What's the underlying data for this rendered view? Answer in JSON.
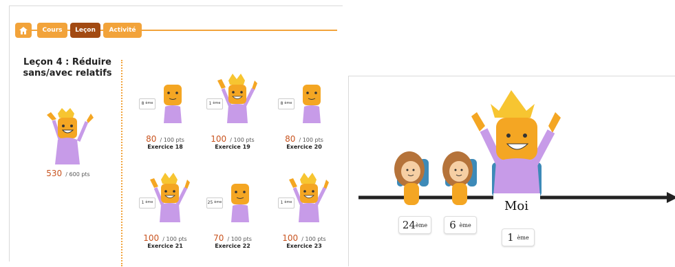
{
  "nav": {
    "tabs": [
      {
        "label": "",
        "icon": "home-icon"
      },
      {
        "label": "Cours"
      },
      {
        "label": "Leçon"
      },
      {
        "label": "Activité"
      }
    ],
    "active_index": 2
  },
  "lesson": {
    "title": "Leçon 4 : Réduire sans/avec relatifs",
    "total_score": "530",
    "total_max": "/ 600 pts"
  },
  "exercises": [
    {
      "rank": "8",
      "rank_sup": "ème",
      "score": "80",
      "max": "/ 100 pts",
      "label": "Exercice 18",
      "crown": false
    },
    {
      "rank": "1",
      "rank_sup": "ème",
      "score": "100",
      "max": "/ 100 pts",
      "label": "Exercice 19",
      "crown": true
    },
    {
      "rank": "8",
      "rank_sup": "ème",
      "score": "80",
      "max": "/ 100 pts",
      "label": "Exercice 20",
      "crown": false
    },
    {
      "rank": "1",
      "rank_sup": "ème",
      "score": "100",
      "max": "/ 100 pts",
      "label": "Exercice 21",
      "crown": true
    },
    {
      "rank": "25",
      "rank_sup": "ème",
      "score": "70",
      "max": "/ 100 pts",
      "label": "Exercice 22",
      "crown": false
    },
    {
      "rank": "1",
      "rank_sup": "ème",
      "score": "100",
      "max": "/ 100 pts",
      "label": "Exercice 23",
      "crown": true
    }
  ],
  "ranking": {
    "boxes": [
      {
        "rank": "24",
        "sup": "ème"
      },
      {
        "rank": "6",
        "sup": "ème"
      },
      {
        "rank": "1",
        "sup": "ème"
      }
    ],
    "me_label": "Moi"
  },
  "colors": {
    "orange": "#f2a33a",
    "active_tab": "#a24a12",
    "score": "#c8531e",
    "body_purple": "#c79be8",
    "head_orange": "#f4a623",
    "crown": "#f7c531"
  }
}
